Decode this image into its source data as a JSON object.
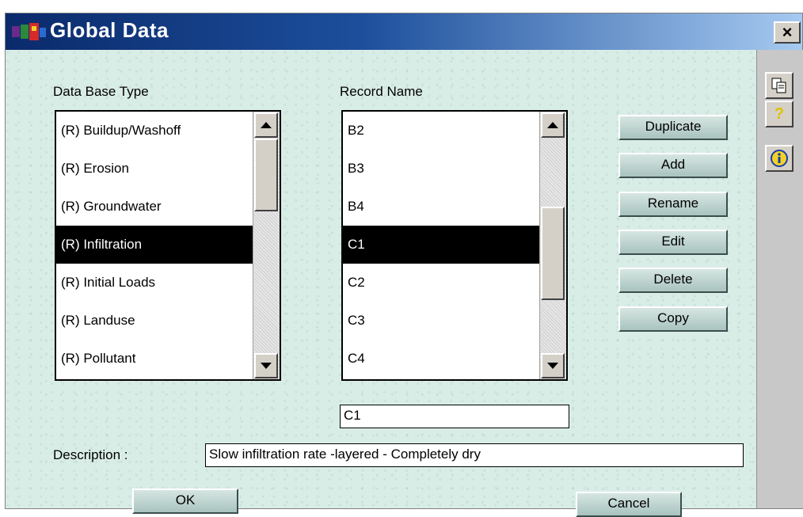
{
  "window": {
    "title": "Global Data",
    "close_label": "×",
    "accent": "#1d4f9c"
  },
  "database_type": {
    "label": "Data Base Type",
    "items": [
      {
        "label": "(R) Buildup/Washoff"
      },
      {
        "label": "(R) Erosion"
      },
      {
        "label": "(R) Groundwater"
      },
      {
        "label": "(R) Infiltration",
        "selected": true
      },
      {
        "label": "(R) Initial Loads"
      },
      {
        "label": "(R) Landuse"
      },
      {
        "label": "(R) Pollutant"
      }
    ]
  },
  "record_name": {
    "label": "Record Name",
    "items": [
      {
        "label": "B2"
      },
      {
        "label": "B3"
      },
      {
        "label": "B4"
      },
      {
        "label": "C1",
        "selected": true
      },
      {
        "label": "C2"
      },
      {
        "label": "C3"
      },
      {
        "label": "C4"
      }
    ],
    "current_value": "C1"
  },
  "actions": {
    "duplicate": "Duplicate",
    "add": "Add",
    "rename": "Rename",
    "edit": "Edit",
    "delete": "Delete",
    "copy": "Copy"
  },
  "description": {
    "label": "Description :",
    "value": "Slow infiltration rate -layered  - Completely dry"
  },
  "footer": {
    "ok": "OK",
    "cancel": "Cancel"
  },
  "side_toolbar": {
    "icons": [
      "copy-icon",
      "help-icon",
      "info-icon"
    ]
  }
}
